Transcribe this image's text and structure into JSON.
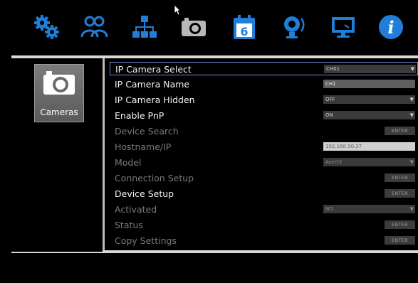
{
  "toolbar": {
    "icons": [
      "gears-icon",
      "users-icon",
      "network-icon",
      "camera-icon",
      "calendar-icon",
      "alarm-icon",
      "monitor-icon",
      "info-icon"
    ],
    "calendar_day": "6",
    "info_glyph": "i"
  },
  "sidebar": {
    "camera_tile_label": "Cameras"
  },
  "settings": {
    "rows": [
      {
        "label": "IP Camera Select",
        "control": "dropdown",
        "value": "CH01",
        "state": "enabled",
        "selected": true
      },
      {
        "label": "IP Camera Name",
        "control": "text",
        "value": "CH1",
        "state": "enabled"
      },
      {
        "label": "IP Camera Hidden",
        "control": "dropdown",
        "value": "OFF",
        "state": "enabled"
      },
      {
        "label": "Enable PnP",
        "control": "dropdown",
        "value": "ON",
        "state": "enabled"
      },
      {
        "label": "Device Search",
        "control": "button",
        "value": "ENTER",
        "state": "disabled"
      },
      {
        "label": "Hostname/IP",
        "control": "text",
        "value": "192.168.50.37",
        "state": "disabled"
      },
      {
        "label": "Model",
        "control": "dropdown",
        "value": "AvertX",
        "state": "disabled"
      },
      {
        "label": "Connection Setup",
        "control": "button",
        "value": "ENTER",
        "state": "disabled"
      },
      {
        "label": "Device Setup",
        "control": "button",
        "value": "ENTER",
        "state": "enabled"
      },
      {
        "label": "Activated",
        "control": "dropdown",
        "value": "NO",
        "state": "disabled"
      },
      {
        "label": "Status",
        "control": "button",
        "value": "ENTER",
        "state": "disabled"
      },
      {
        "label": "Copy Settings",
        "control": "button",
        "value": "ENTER",
        "state": "disabled"
      }
    ]
  },
  "colors": {
    "icon_blue": "#1f7fd8",
    "frame": "#d9d9d9",
    "selection_border": "#6d8fd6"
  }
}
